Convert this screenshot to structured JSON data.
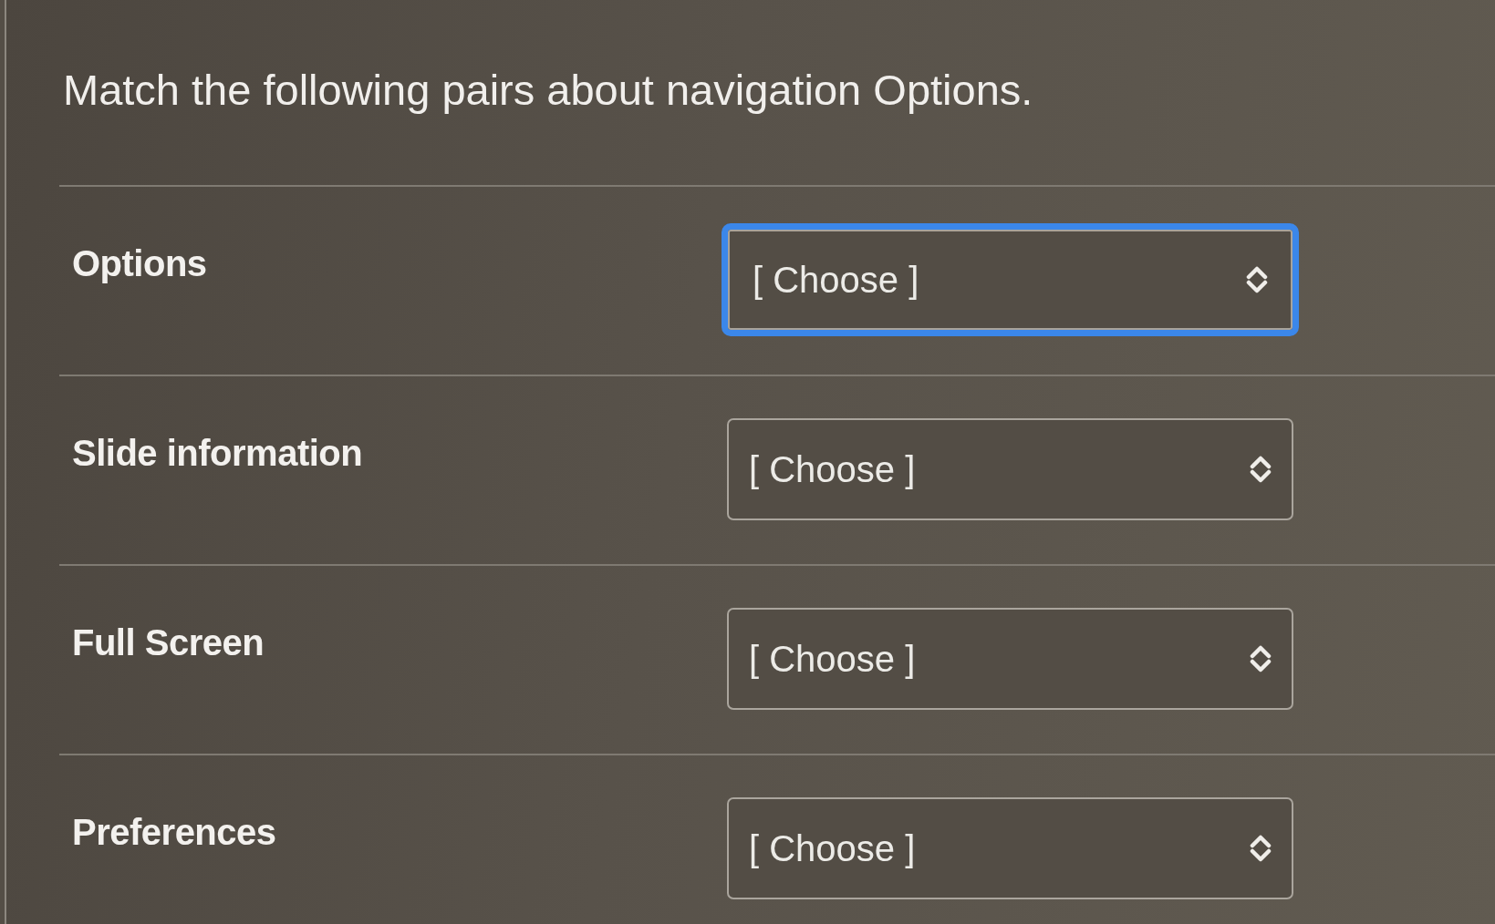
{
  "question": "Match the following pairs about navigation Options.",
  "pairs": [
    {
      "label": "Options",
      "answer": {
        "value": "[ Choose ]",
        "focused": true
      }
    },
    {
      "label": "Slide information",
      "answer": {
        "value": "[ Choose ]",
        "focused": false
      }
    },
    {
      "label": "Full Screen",
      "answer": {
        "value": "[ Choose ]",
        "focused": false
      }
    },
    {
      "label": "Preferences",
      "answer": {
        "value": "[ Choose ]",
        "focused": false
      }
    }
  ]
}
